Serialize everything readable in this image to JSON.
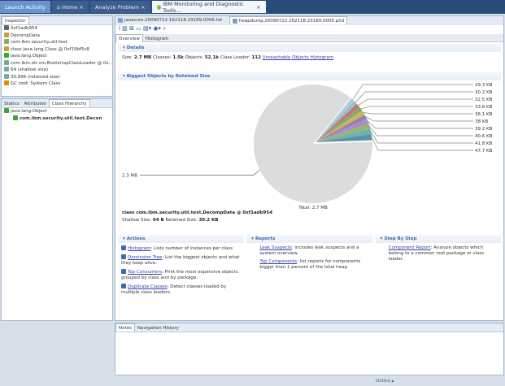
{
  "topbar": {
    "tabs": [
      {
        "label": "Launch Activity"
      },
      {
        "label": "Home"
      },
      {
        "label": "Analyze Problem"
      },
      {
        "label": "IBM Monitoring and Diagnostic Tools..."
      }
    ]
  },
  "inspector": {
    "title": "Inspector",
    "items": [
      "0xf1adb954",
      "DecompData",
      "com.ibm.security.util.text",
      "class java.lang.Class @ 0xf19bf5c8",
      "java.lang.Object",
      "com.ibm.oti.vm.BootstrapClassLoader @ 0x...",
      "64 (shallow size)",
      "30,896 (retained size)",
      "GC root: System Class"
    ],
    "tabs": [
      "Statics",
      "Attributes",
      "Class Hierarchy"
    ],
    "tree": [
      "java.lang.Object",
      "com.ibm.security.util.text.Decon"
    ]
  },
  "editor": {
    "tabs": [
      "javacore.20090722.162118.23189.0006.txt",
      "heapdump.20090722.162118.23189.0005.phd"
    ],
    "subtabs": [
      "Overview",
      "Histogram"
    ],
    "details": {
      "title": "Details",
      "size_label": "Size:",
      "size": "2.7 MB",
      "classes_label": "Classes:",
      "classes": "1.5k",
      "objects_label": "Objects:",
      "objects": "52.1k",
      "loader_label": "Class Loader:",
      "loader": "112",
      "link": "Unreachable Objects Histogram"
    },
    "biggest": {
      "title": "Biggest Objects by Retained Size",
      "total": "Total: 2.7 MB",
      "class_line": "class com.ibm.security.util.text.DecompData @ 0xf1adb954",
      "shallow_label": "Shallow Size:",
      "shallow": "64 B",
      "retained_label": "Retained Size:",
      "retained": "30.2 KB"
    },
    "actions": {
      "title": "Actions",
      "items": [
        {
          "link": "Histogram",
          "text": ": Lists number of instances per class"
        },
        {
          "link": "Dominator Tree",
          "text": ": List the biggest objects and what they keep alive."
        },
        {
          "link": "Top Consumers",
          "text": ": Print the most expensive objects grouped by class and by package."
        },
        {
          "link": "Duplicate Classes",
          "text": ": Detect classes loaded by multiple class loaders."
        }
      ]
    },
    "reports": {
      "title": "Reports",
      "items": [
        {
          "link": "Leak Suspects",
          "text": ": includes leak suspects and a system overview"
        },
        {
          "link": "Top Components",
          "text": ": list reports for components bigger than 1 percent of the total heap."
        }
      ]
    },
    "step": {
      "title": "Step By Step",
      "items": [
        {
          "link": "Component Report",
          "text": ": Analyze objects which belong to a common root package or class loader."
        }
      ]
    }
  },
  "chart_data": {
    "type": "pie",
    "total": "2.7 MB",
    "slices": [
      {
        "label": "2.3 MB",
        "value_kb": 2355,
        "color": "#dcdcdc"
      },
      {
        "label": "47.7 KB",
        "value_kb": 47.7,
        "color": "#5f8fa8"
      },
      {
        "label": "41.8 KB",
        "value_kb": 41.8,
        "color": "#6fb0b0"
      },
      {
        "label": "40.6 KB",
        "value_kb": 40.6,
        "color": "#8bbd6a"
      },
      {
        "label": "39.2 KB",
        "value_kb": 39.2,
        "color": "#b08cc0"
      },
      {
        "label": "38 KB",
        "value_kb": 38,
        "color": "#9a7fb5"
      },
      {
        "label": "36.1 KB",
        "value_kb": 36.1,
        "color": "#c9b460"
      },
      {
        "label": "33.8 KB",
        "value_kb": 33.8,
        "color": "#8aa86a"
      },
      {
        "label": "32.5 KB",
        "value_kb": 32.5,
        "color": "#c07870"
      },
      {
        "label": "30.2 KB",
        "value_kb": 30.2,
        "color": "#a0b8d0"
      },
      {
        "label": "29.3 KB",
        "value_kb": 29.3,
        "color": "#a8cfd8"
      }
    ]
  },
  "notes": {
    "tabs": [
      "Notes",
      "Navigation History"
    ]
  },
  "status": {
    "text": "Online"
  }
}
